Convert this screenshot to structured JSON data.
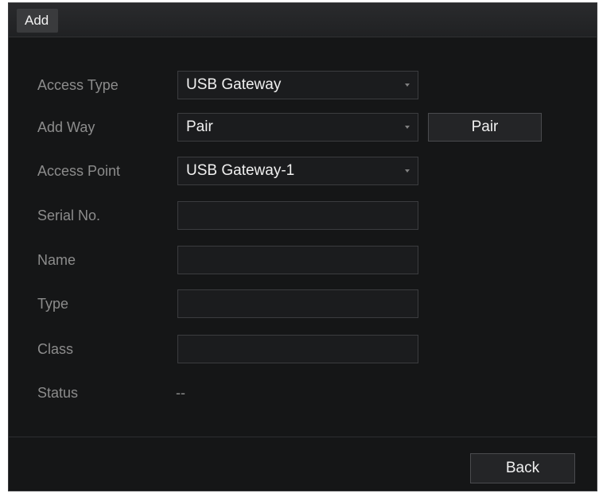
{
  "dialog": {
    "title": "Add"
  },
  "form": {
    "access_type": {
      "label": "Access Type",
      "value": "USB Gateway"
    },
    "add_way": {
      "label": "Add Way",
      "value": "Pair",
      "button_label": "Pair"
    },
    "access_point": {
      "label": "Access Point",
      "value": "USB Gateway-1"
    },
    "serial_no": {
      "label": "Serial No.",
      "value": ""
    },
    "name": {
      "label": "Name",
      "value": ""
    },
    "type": {
      "label": "Type",
      "value": ""
    },
    "class": {
      "label": "Class",
      "value": ""
    },
    "status": {
      "label": "Status",
      "value": "--"
    }
  },
  "footer": {
    "back_label": "Back"
  },
  "icons": {
    "dropdown": "chevron-down-icon"
  },
  "colors": {
    "background": "#151617",
    "label_text": "#8c8c8c",
    "value_text": "#f0f0f0",
    "field_border": "#3b3c3f"
  }
}
